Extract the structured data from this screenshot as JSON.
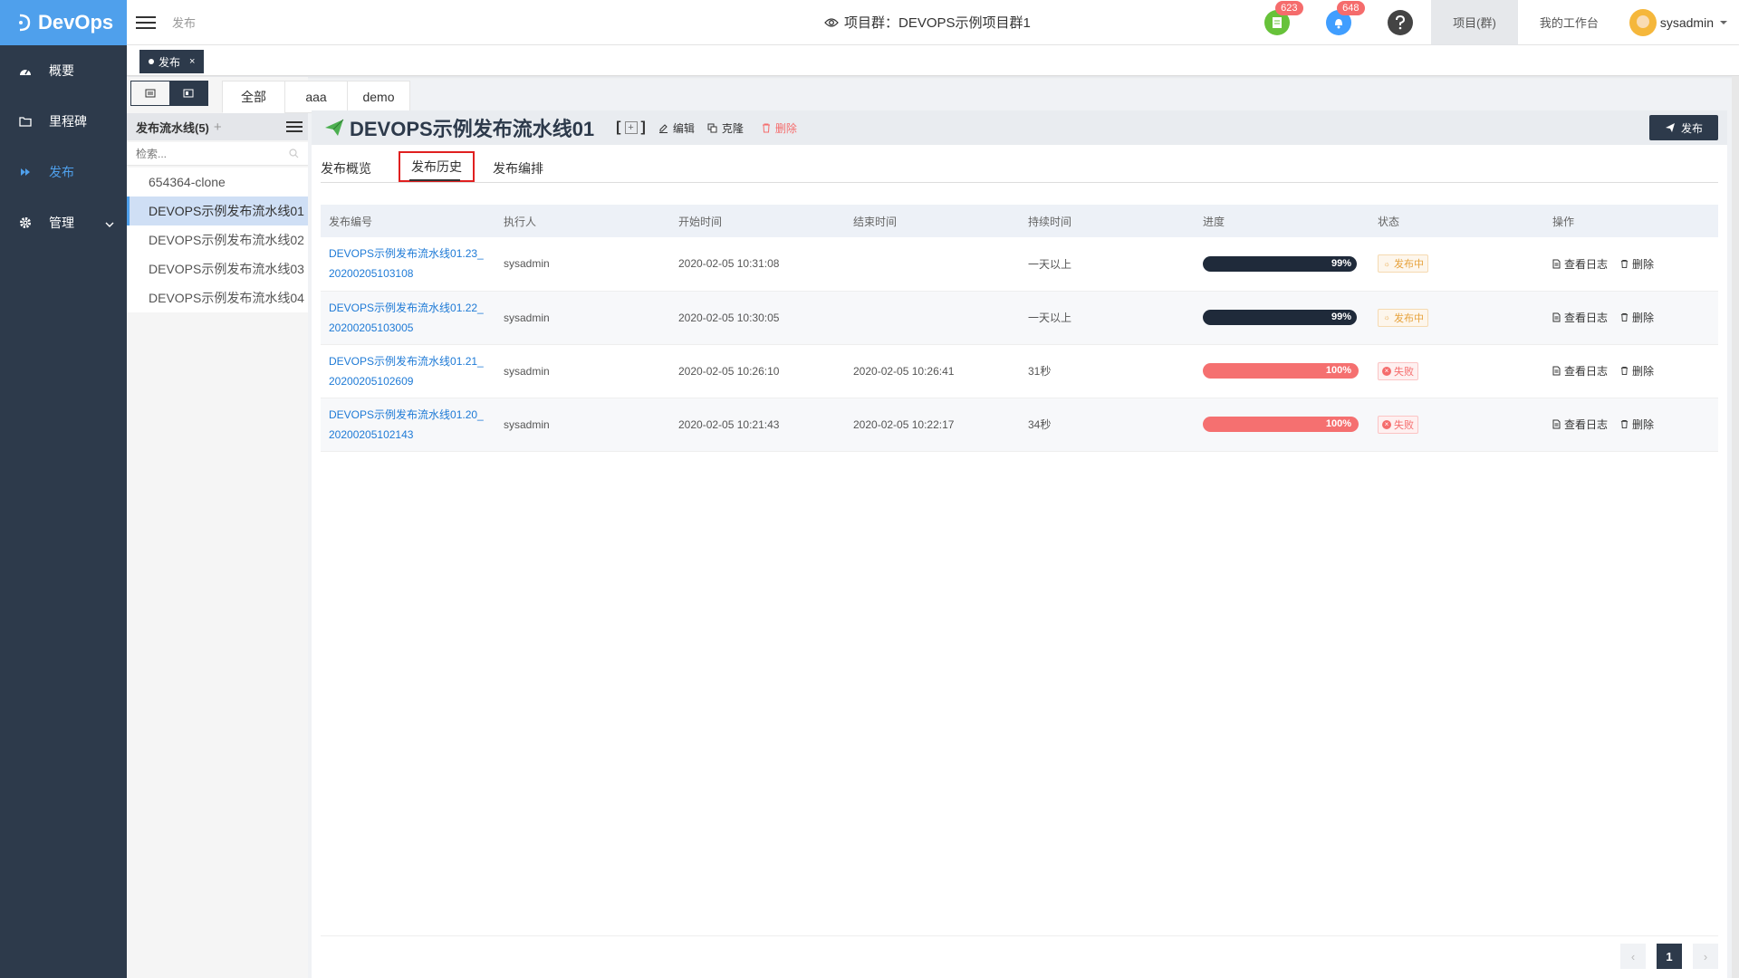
{
  "app": {
    "logo_text": "DevOps"
  },
  "sidebar": {
    "items": [
      {
        "label": "概要",
        "icon": "dashboard-icon"
      },
      {
        "label": "里程碑",
        "icon": "folder-icon"
      },
      {
        "label": "发布",
        "icon": "forward-icon",
        "active": true
      },
      {
        "label": "管理",
        "icon": "gear-icon"
      }
    ]
  },
  "header": {
    "breadcrumb": "发布",
    "project_title": "项目群：DEVOPS示例项目群1",
    "badge_tasks": "623",
    "badge_notifications": "648",
    "tab_projects": "项目(群)",
    "tab_workbench": "我的工作台",
    "username": "sysadmin"
  },
  "tagbar": {
    "tag_label": "发布",
    "close": "×"
  },
  "left": {
    "group_tabs": [
      "全部",
      "aaa",
      "demo"
    ],
    "list_title": "发布流水线(5)",
    "add": "+",
    "search_placeholder": "检索...",
    "pipelines": [
      "654364-clone",
      "DEVOPS示例发布流水线01",
      "DEVOPS示例发布流水线02",
      "DEVOPS示例发布流水线03",
      "DEVOPS示例发布流水线04"
    ]
  },
  "main": {
    "title": "DEVOPS示例发布流水线01",
    "bracket_open": "[",
    "bracket_plus": "+",
    "bracket_close": "]",
    "edit": "编辑",
    "clone": "克隆",
    "delete": "删除",
    "publish": "发布",
    "tabs": [
      "发布概览",
      "发布历史",
      "发布编排"
    ],
    "columns": [
      "发布编号",
      "执行人",
      "开始时间",
      "结束时间",
      "持续时间",
      "进度",
      "状态",
      "操作"
    ],
    "rows": [
      {
        "id1": "DEVOPS示例发布流水线01.23_",
        "id2": "20200205103108",
        "executor": "sysadmin",
        "start": "2020-02-05 10:31:08",
        "end": "",
        "duration": "一天以上",
        "progress": "99%",
        "progress_value": 99,
        "status": "发布中",
        "view_log": "查看日志",
        "delete": "删除"
      },
      {
        "id1": "DEVOPS示例发布流水线01.22_",
        "id2": "20200205103005",
        "executor": "sysadmin",
        "start": "2020-02-05 10:30:05",
        "end": "",
        "duration": "一天以上",
        "progress": "99%",
        "progress_value": 99,
        "status": "发布中",
        "view_log": "查看日志",
        "delete": "删除"
      },
      {
        "id1": "DEVOPS示例发布流水线01.21_",
        "id2": "20200205102609",
        "executor": "sysadmin",
        "start": "2020-02-05 10:26:10",
        "end": "2020-02-05 10:26:41",
        "duration": "31秒",
        "progress": "100%",
        "progress_value": 100,
        "status": "失败",
        "view_log": "查看日志",
        "delete": "删除"
      },
      {
        "id1": "DEVOPS示例发布流水线01.20_",
        "id2": "20200205102143",
        "executor": "sysadmin",
        "start": "2020-02-05 10:21:43",
        "end": "2020-02-05 10:22:17",
        "duration": "34秒",
        "progress": "100%",
        "progress_value": 100,
        "status": "失败",
        "view_log": "查看日志",
        "delete": "删除"
      }
    ],
    "pagination": {
      "current": "1",
      "prev": "‹",
      "next": "›"
    }
  },
  "colors": {
    "sidebar_bg": "#2d3a4b",
    "accent": "#4fa0ec",
    "progress_running": "#1f2a3a",
    "progress_failed": "#f57070",
    "highlight_box": "#e02020"
  }
}
